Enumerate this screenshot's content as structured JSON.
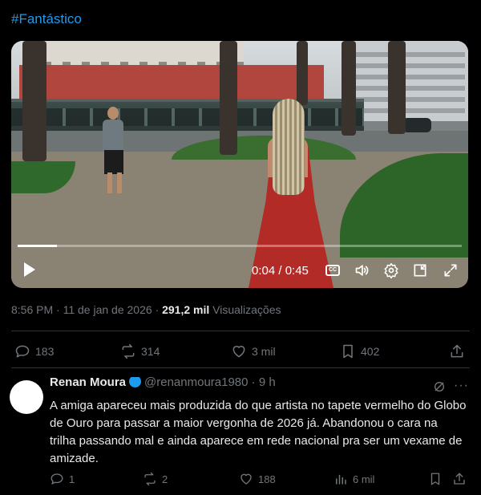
{
  "post": {
    "hashtag": "#Fantástico",
    "video": {
      "current_time": "0:04",
      "duration": "0:45",
      "time_display": "0:04 / 0:45",
      "progress_fraction": 0.089,
      "cc_label": "CC"
    },
    "meta": {
      "timestamp": "8:56 PM · 11 de jan de 2026 · ",
      "views_count": "291,2 mil",
      "views_label": " Visualizações"
    },
    "actions": {
      "replies": "183",
      "reposts": "314",
      "likes": "3 mil",
      "bookmarks": "402"
    }
  },
  "reply": {
    "name": "Renan Moura",
    "handle": "@renanmoura1980",
    "time": "· 9 h",
    "more": "···",
    "text": "A amiga apareceu mais produzida do que artista no tapete vermelho do Globo de Ouro para passar a maior vergonha de 2026 já. Abandonou o cara na trilha passando mal e ainda aparece em rede nacional pra ser um vexame de amizade.",
    "actions": {
      "replies": "1",
      "reposts": "2",
      "likes": "188",
      "views": "6 mil"
    }
  },
  "colors": {
    "accent": "#1d9bf0",
    "muted": "#71767b",
    "text": "#e7e9ea",
    "background": "#000000"
  }
}
